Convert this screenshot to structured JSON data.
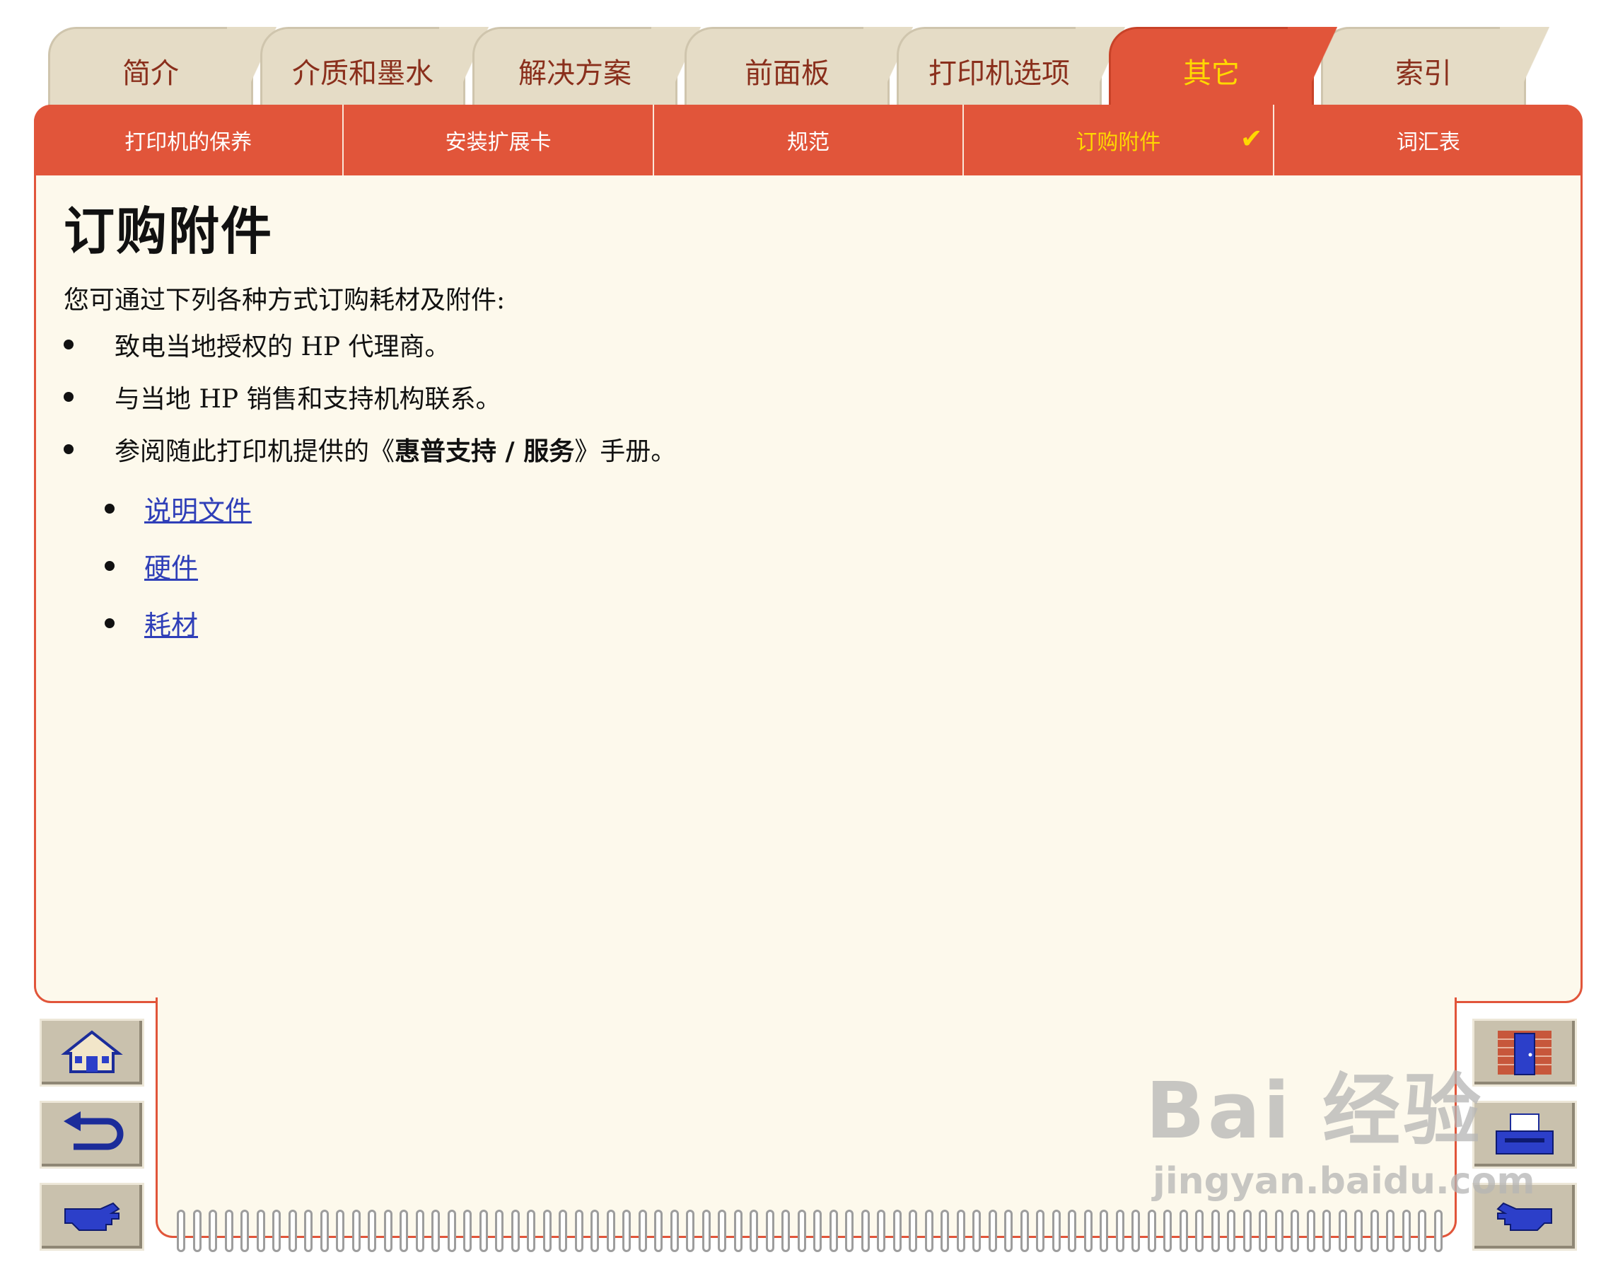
{
  "tabs": [
    {
      "label": "简介",
      "active": false
    },
    {
      "label": "介质和墨水",
      "active": false
    },
    {
      "label": "解决方案",
      "active": false
    },
    {
      "label": "前面板",
      "active": false
    },
    {
      "label": "打印机选项",
      "active": false
    },
    {
      "label": "其它",
      "active": true
    },
    {
      "label": "索引",
      "active": false
    }
  ],
  "subnav": [
    {
      "label": "打印机的保养"
    },
    {
      "label": "安装扩展卡"
    },
    {
      "label": "规范"
    },
    {
      "label": "订购附件",
      "active": true,
      "check": "✔"
    },
    {
      "label": "词汇表"
    }
  ],
  "page": {
    "title": "订购附件",
    "intro": "您可通过下列各种方式订购耗材及附件:",
    "bullets": [
      "致电当地授权的 HP 代理商。",
      "与当地 HP 销售和支持机构联系。"
    ],
    "bullet3_prefix": "参阅随此打印机提供的《",
    "bullet3_bold": "惠普支持 / 服务",
    "bullet3_suffix": "》手册。",
    "links": [
      "说明文件",
      "硬件",
      "耗材"
    ]
  },
  "nav_buttons": {
    "left": [
      "home-icon",
      "back-icon",
      "next-page-icon"
    ],
    "right": [
      "exit-door-icon",
      "print-icon",
      "forward-icon"
    ]
  },
  "watermark": {
    "main": "Bai 经验",
    "sub": "jingyan.baidu.com"
  },
  "colors": {
    "accent": "#e1553a",
    "active_text": "#ffd800",
    "tab_bg": "#e5dcc6",
    "page_bg": "#fdf9ec",
    "link": "#2f3fb8"
  }
}
